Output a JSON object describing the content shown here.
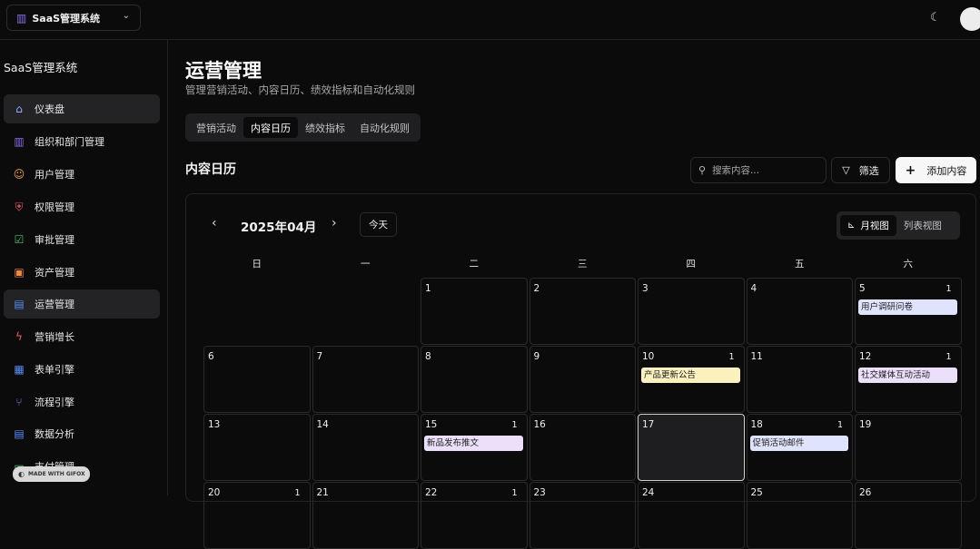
{
  "app": {
    "switcher_label": "SaaS管理系统",
    "theme_icon": "moon-icon"
  },
  "sidebar": {
    "title": "SaaS管理系统",
    "items": [
      {
        "label": "仪表盘",
        "icon": "home-icon",
        "glyph": "⌂",
        "color": "#8fb0ff",
        "active": true
      },
      {
        "label": "组织和部门管理",
        "icon": "building-icon",
        "glyph": "▥",
        "color": "#8f6ff0",
        "active": false
      },
      {
        "label": "用户管理",
        "icon": "users-icon",
        "glyph": "☺",
        "color": "#f0a050",
        "active": false
      },
      {
        "label": "权限管理",
        "icon": "shield-icon",
        "glyph": "⛨",
        "color": "#ef5a5a",
        "active": false
      },
      {
        "label": "审批管理",
        "icon": "clipboard-check-icon",
        "glyph": "☑",
        "color": "#4cc36b",
        "active": false
      },
      {
        "label": "资产管理",
        "icon": "image-icon",
        "glyph": "▣",
        "color": "#f08a3c",
        "active": false
      },
      {
        "label": "运营管理",
        "icon": "bar-chart-icon",
        "glyph": "▤",
        "color": "#5b8cf5",
        "active": true
      },
      {
        "label": "营销增长",
        "icon": "zap-icon",
        "glyph": "ϟ",
        "color": "#ef5a5a",
        "active": false
      },
      {
        "label": "表单引擎",
        "icon": "table-icon",
        "glyph": "▦",
        "color": "#5b8cf5",
        "active": false
      },
      {
        "label": "流程引擎",
        "icon": "git-branch-icon",
        "glyph": "⑂",
        "color": "#8f6ff0",
        "active": false
      },
      {
        "label": "数据分析",
        "icon": "chart-icon",
        "glyph": "▤",
        "color": "#5b8cf5",
        "active": false
      },
      {
        "label": "支付管理",
        "icon": "card-icon",
        "glyph": "▭",
        "color": "#4cc36b",
        "active": false
      }
    ]
  },
  "page": {
    "title": "运营管理",
    "subtitle": "管理营销活动、内容日历、绩效指标和自动化规则",
    "tabs": [
      "营销活动",
      "内容日历",
      "绩效指标",
      "自动化规则"
    ],
    "active_tab": "内容日历"
  },
  "section": {
    "title": "内容日历",
    "search_placeholder": "搜索内容...",
    "filter_label": "筛选",
    "add_label": "添加内容"
  },
  "calendar": {
    "month_label": "2025年04月",
    "today_label": "今天",
    "view_month_label": "月视图",
    "view_list_label": "列表视图",
    "weekdays": [
      "日",
      "一",
      "二",
      "三",
      "四",
      "五",
      "六"
    ],
    "weeks": [
      [
        {
          "day": ""
        },
        {
          "day": ""
        },
        {
          "day": "1"
        },
        {
          "day": "2"
        },
        {
          "day": "3"
        },
        {
          "day": "4"
        },
        {
          "day": "5",
          "count": "1",
          "event": {
            "title": "用户调研问卷",
            "color": "#dfe3fb"
          }
        }
      ],
      [
        {
          "day": "6"
        },
        {
          "day": "7"
        },
        {
          "day": "8"
        },
        {
          "day": "9"
        },
        {
          "day": "10",
          "count": "1",
          "event": {
            "title": "产品更新公告",
            "color": "#fbf1bf"
          }
        },
        {
          "day": "11"
        },
        {
          "day": "12",
          "count": "1",
          "event": {
            "title": "社交媒体互动活动",
            "color": "#ebdffa"
          }
        }
      ],
      [
        {
          "day": "13"
        },
        {
          "day": "14"
        },
        {
          "day": "15",
          "count": "1",
          "event": {
            "title": "新品发布推文",
            "color": "#ebdffa"
          }
        },
        {
          "day": "16"
        },
        {
          "day": "17",
          "today": true
        },
        {
          "day": "18",
          "count": "1",
          "event": {
            "title": "促销活动邮件",
            "color": "#dfe3fb"
          }
        },
        {
          "day": "19"
        }
      ],
      [
        {
          "day": "20",
          "count": "1"
        },
        {
          "day": "21"
        },
        {
          "day": "22",
          "count": "1"
        },
        {
          "day": "23"
        },
        {
          "day": "24"
        },
        {
          "day": "25"
        },
        {
          "day": "26"
        }
      ]
    ]
  },
  "watermark": {
    "label": "MADE WITH GIFOX"
  }
}
